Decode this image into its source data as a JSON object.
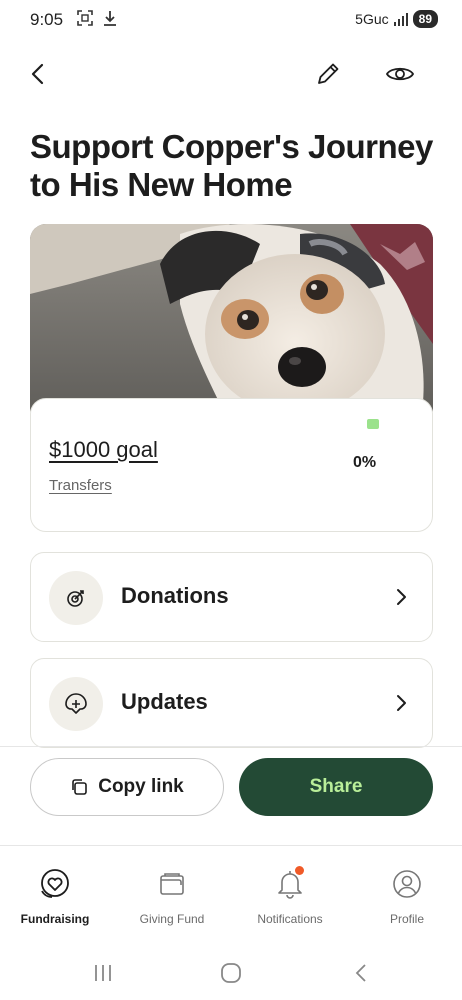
{
  "status_bar": {
    "time": "9:05",
    "network": "5Guc",
    "battery": "89"
  },
  "header": {
    "back_icon": "chevron-left-icon",
    "edit_icon": "pencil-icon",
    "view_icon": "eye-icon"
  },
  "page": {
    "title": "Support Copper's Journey to His New Home"
  },
  "goal": {
    "amount_label": "$1000 goal",
    "transfers_label": "Transfers",
    "percent": "0%",
    "progress_fraction": 0,
    "progress_color": "#9be28c"
  },
  "rows": [
    {
      "label": "Donations",
      "icon": "donation-target-icon"
    },
    {
      "label": "Updates",
      "icon": "add-update-icon"
    }
  ],
  "actions": {
    "copy_label": "Copy link",
    "share_label": "Share",
    "share_bg": "#234a35",
    "share_text": "#b9ee99"
  },
  "tabs": [
    {
      "label": "Fundraising",
      "icon": "fundraising-heart-icon",
      "active": true
    },
    {
      "label": "Giving Fund",
      "icon": "wallet-icon",
      "active": false
    },
    {
      "label": "Notifications",
      "icon": "bell-icon",
      "active": false,
      "badge": true
    },
    {
      "label": "Profile",
      "icon": "profile-icon",
      "active": false
    }
  ]
}
